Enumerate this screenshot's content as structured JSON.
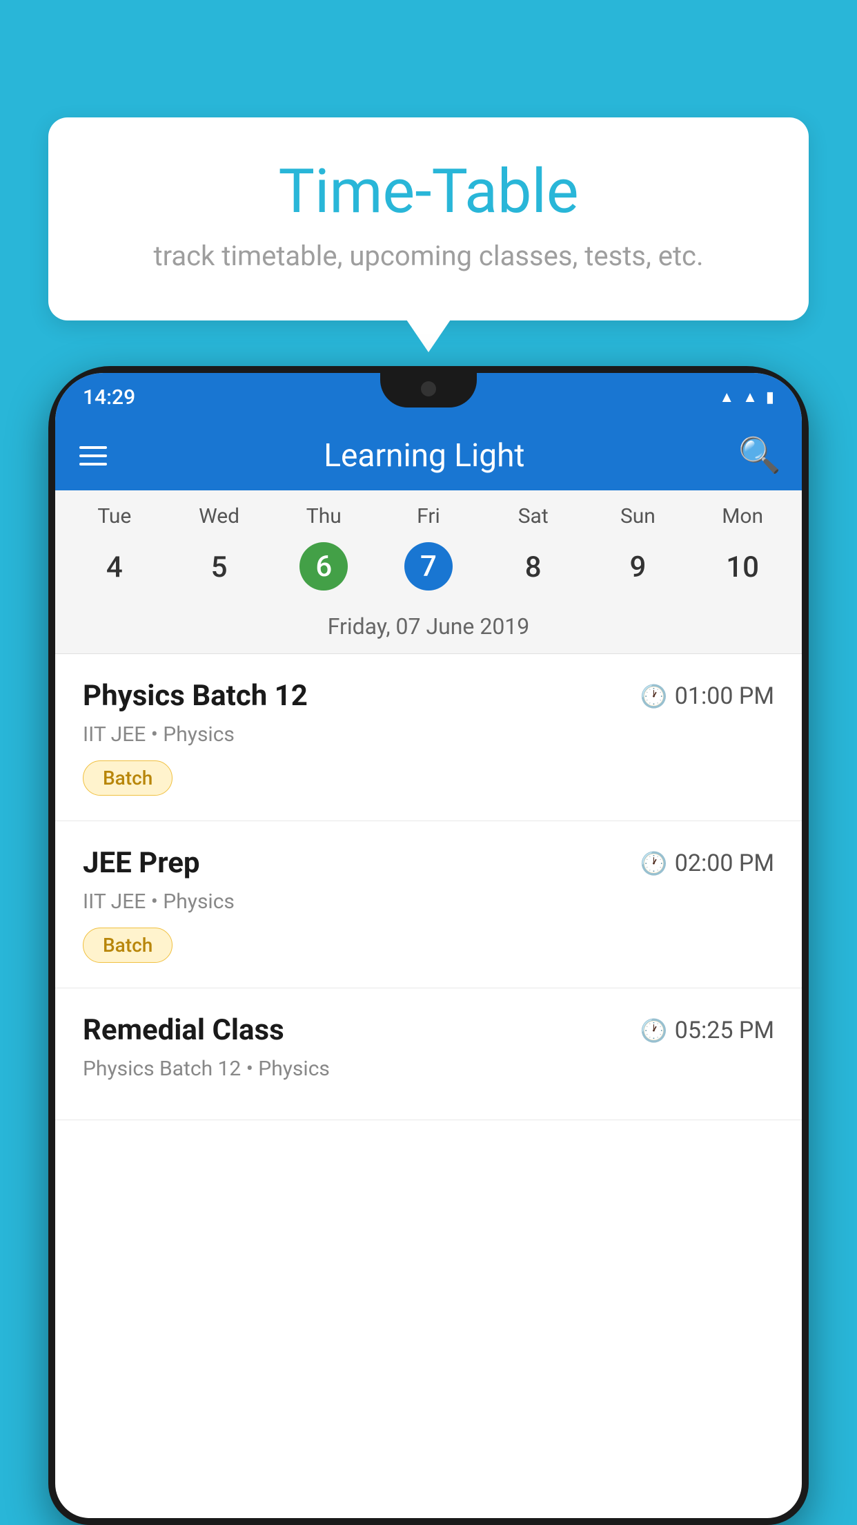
{
  "background_color": "#29b6d8",
  "tooltip": {
    "title": "Time-Table",
    "subtitle": "track timetable, upcoming classes, tests, etc."
  },
  "phone": {
    "status_bar": {
      "time": "14:29"
    },
    "app_bar": {
      "title": "Learning Light"
    },
    "calendar": {
      "days": [
        "Tue",
        "Wed",
        "Thu",
        "Fri",
        "Sat",
        "Sun",
        "Mon"
      ],
      "dates": [
        "4",
        "5",
        "6",
        "7",
        "8",
        "9",
        "10"
      ],
      "today_index": 2,
      "selected_index": 3,
      "current_date_label": "Friday, 07 June 2019"
    },
    "schedule": [
      {
        "title": "Physics Batch 12",
        "time": "01:00 PM",
        "subtitle": "IIT JEE • Physics",
        "badge": "Batch"
      },
      {
        "title": "JEE Prep",
        "time": "02:00 PM",
        "subtitle": "IIT JEE • Physics",
        "badge": "Batch"
      },
      {
        "title": "Remedial Class",
        "time": "05:25 PM",
        "subtitle": "Physics Batch 12 • Physics",
        "badge": null
      }
    ]
  },
  "icons": {
    "hamburger": "≡",
    "search": "🔍",
    "clock": "🕐"
  }
}
